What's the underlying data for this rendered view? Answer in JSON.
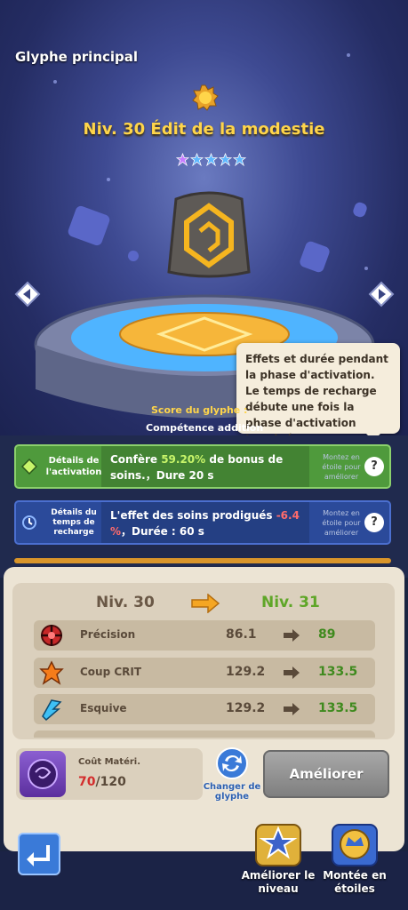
{
  "header": {
    "title": "Glyphe principal"
  },
  "glyph": {
    "name": "Niv. 30 Édit de la modestie",
    "stars": 5
  },
  "tooltip": {
    "text": "Effets et durée pendant la phase d'activation. Le temps de recharge débute une fois la phase d'activation terminée."
  },
  "score": {
    "label": "Score du glyphe :"
  },
  "extra": {
    "label": "Compétence addition"
  },
  "activation": {
    "label_line1": "Détails de",
    "label_line2": "l'activation",
    "text_pre": "Confère ",
    "text_pct": "59.20%",
    "text_post": " de bonus de soins.，Dure 20 s",
    "lock_line1": "Montez en",
    "lock_line2": "étoile pour",
    "lock_line3": "améliorer",
    "help": "?"
  },
  "cooldown": {
    "label_line1": "Détails du",
    "label_line2": "temps de",
    "label_line3": "recharge",
    "text_pre": "L'effet des soins prodigués ",
    "text_val": "-6.4",
    "text_pct": "%",
    "text_post": "，Durée : 60 s",
    "lock_line1": "Montez en",
    "lock_line2": "étoile pour",
    "lock_line3": "améliorer",
    "help": "?"
  },
  "upgrade": {
    "current_level": "Niv. 30",
    "next_level": "Niv. 31",
    "stats": [
      {
        "name": "Précision",
        "old": "86.1",
        "new": "89",
        "icon": "crosshair-icon"
      },
      {
        "name": "Coup CRIT",
        "old": "129.2",
        "new": "133.5",
        "icon": "crit-icon"
      },
      {
        "name": "Esquive",
        "old": "129.2",
        "new": "133.5",
        "icon": "dodge-icon"
      }
    ]
  },
  "material": {
    "label": "Coût Matéri.",
    "have": "70",
    "need": "/120"
  },
  "actions": {
    "change_line1": "Changer de",
    "change_line2": "glyphe",
    "upgrade": "Améliorer"
  },
  "tabs": {
    "level_line1": "Améliorer le",
    "level_line2": "niveau",
    "star_line1": "Montée en",
    "star_line2": "étoiles"
  },
  "colors": {
    "accent": "#ffd54a",
    "activation_bg": "#4f9a3c",
    "cooldown_bg": "#2b4a9a",
    "increase": "#3f8a1e",
    "deficit": "#d32d2d"
  }
}
